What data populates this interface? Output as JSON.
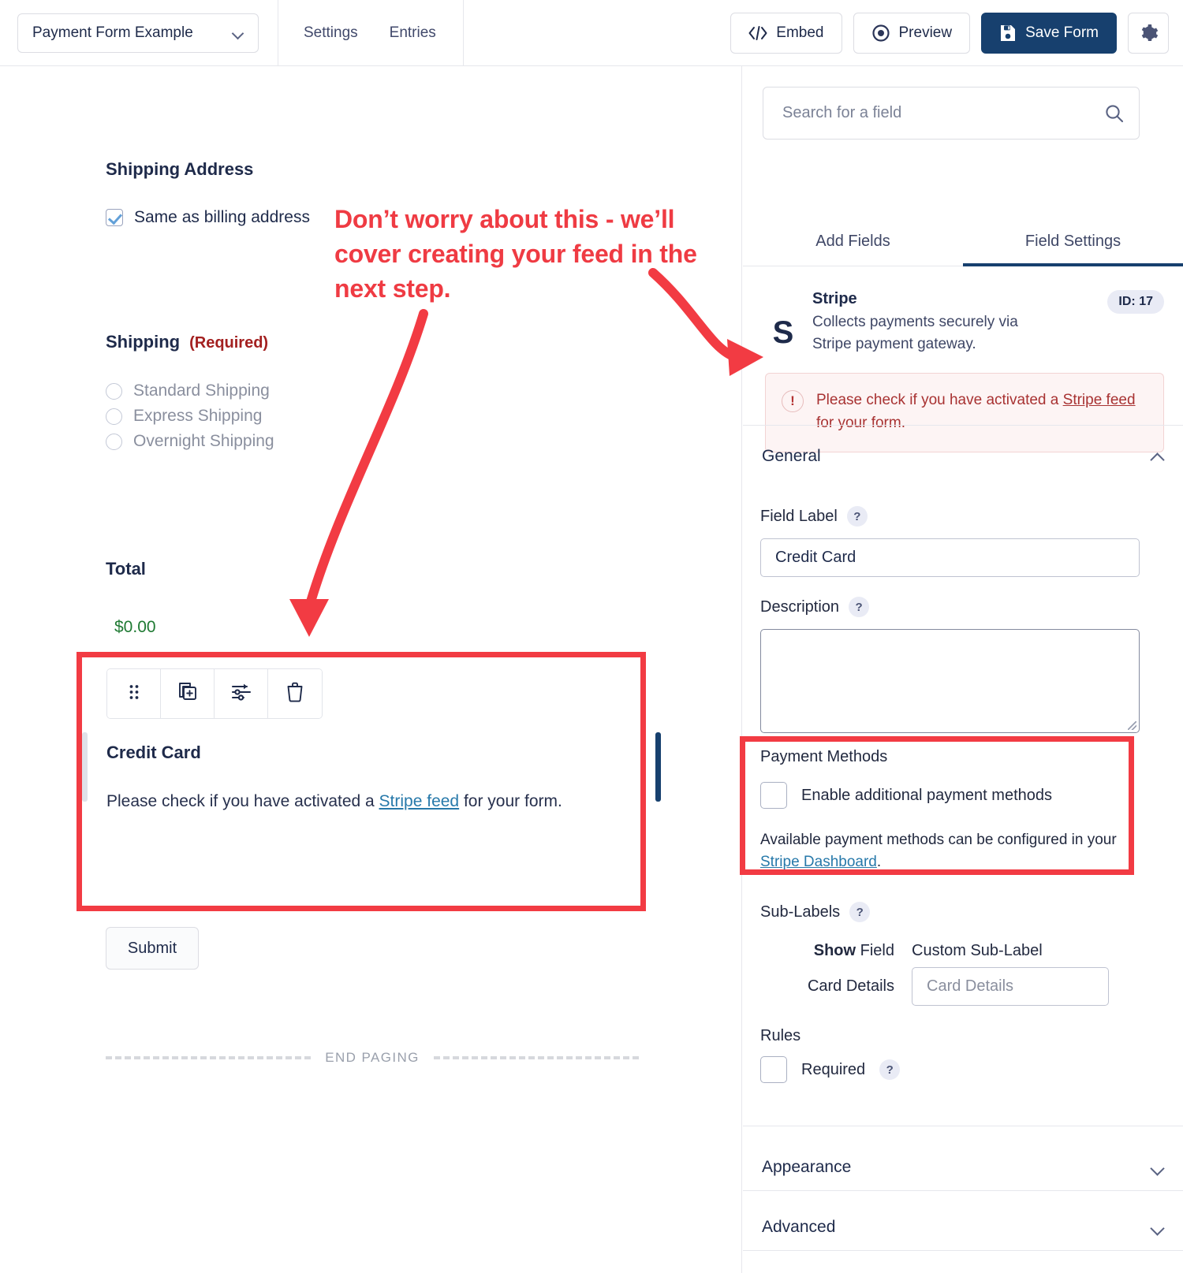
{
  "topbar": {
    "form_name": "Payment Form Example",
    "nav": [
      {
        "label": "Settings",
        "name": "settings"
      },
      {
        "label": "Entries",
        "name": "entries"
      }
    ],
    "embed_label": "Embed",
    "preview_label": "Preview",
    "save_label": "Save Form",
    "gear_icon": "gear-icon"
  },
  "canvas": {
    "shipping_address_title": "Shipping Address",
    "same_as_billing_label": "Same as billing address",
    "same_as_billing_checked": true,
    "shipping_title": "Shipping",
    "shipping_required_tag": "(Required)",
    "shipping_options": [
      "Standard Shipping",
      "Express Shipping",
      "Overnight Shipping"
    ],
    "total_title": "Total",
    "total_amount": "$0.00",
    "field_toolbar": [
      {
        "icon": "drag-handle-icon",
        "name": "drag-handle"
      },
      {
        "icon": "duplicate-icon",
        "name": "duplicate-field"
      },
      {
        "icon": "settings-sliders-icon",
        "name": "field-settings"
      },
      {
        "icon": "trash-icon",
        "name": "delete-field"
      }
    ],
    "credit_card_label": "Credit Card",
    "credit_card_desc_before": "Please check if you have activated a ",
    "credit_card_desc_link": "Stripe feed",
    "credit_card_desc_after": " for your form.",
    "submit_label": "Submit",
    "end_paging_label": "END PAGING"
  },
  "annotation": {
    "line1": "Don’t worry about this - we’ll",
    "line2": "cover creating your feed in the",
    "line3": "next step.",
    "color": "#ef3b43"
  },
  "panel": {
    "search_placeholder": "Search for a field",
    "search_value": "",
    "search_icon": "search-icon",
    "tabs": [
      {
        "label": "Add Fields",
        "name": "add-fields",
        "active": false
      },
      {
        "label": "Field Settings",
        "name": "field-settings",
        "active": true
      }
    ],
    "stripe": {
      "logo": "S",
      "name": "Stripe",
      "description": "Collects payments securely via Stripe payment gateway.",
      "id_badge": "ID: 17",
      "alert_before": "Please check if you have activated a ",
      "alert_link": "Stripe feed",
      "alert_after": " for your form."
    },
    "general": {
      "section_title": "General",
      "field_label_label": "Field Label",
      "field_label_value": "Credit Card",
      "description_label": "Description",
      "description_value": ""
    },
    "payment_methods": {
      "section_title": "Payment Methods",
      "enable_label": "Enable additional payment methods",
      "enable_checked": false,
      "note_before": "Available payment methods can be configured in your ",
      "note_link": "Stripe Dashboard",
      "note_after": "."
    },
    "sub_labels": {
      "section_title": "Sub-Labels",
      "col_show_bold": "Show",
      "col_show_rest": " Field",
      "col_custom": "Custom Sub-Label",
      "row_field": "Card Details",
      "row_placeholder": "Card Details",
      "row_value": ""
    },
    "rules": {
      "section_title": "Rules",
      "required_label": "Required",
      "required_checked": false
    },
    "appearance_title": "Appearance",
    "advanced_title": "Advanced"
  },
  "colors": {
    "accent_navy": "#17406e",
    "annotation_red": "#ef3b43",
    "alert_red": "#a83232",
    "link_blue": "#2779aa",
    "total_green": "#1f7a33"
  }
}
